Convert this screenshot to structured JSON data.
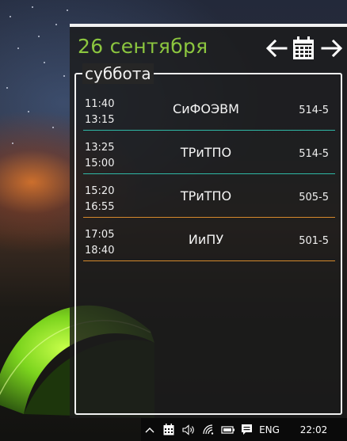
{
  "header": {
    "date": "26 сентября",
    "day": "суббота",
    "accent_color": "#8cc63f",
    "icons": {
      "prev": "arrow-left-icon",
      "calendar": "calendar-icon",
      "next": "arrow-right-icon"
    }
  },
  "lessons": [
    {
      "start": "11:40",
      "end": "13:15",
      "subject": "СиФОЭВМ",
      "room": "514-5",
      "line_color": "#2fb8a6"
    },
    {
      "start": "13:25",
      "end": "15:00",
      "subject": "ТРиТПО",
      "room": "514-5",
      "line_color": "#2fb8a6"
    },
    {
      "start": "15:20",
      "end": "16:55",
      "subject": "ТРиТПО",
      "room": "505-5",
      "line_color": "#d6892c"
    },
    {
      "start": "17:05",
      "end": "18:40",
      "subject": "ИиПУ",
      "room": "501-5",
      "line_color": "#d6892c"
    }
  ],
  "taskbar": {
    "language": "ENG",
    "clock": "22:02",
    "icons": [
      "chevron-up-icon",
      "calendar-tray-icon",
      "volume-icon",
      "network-icon",
      "battery-icon",
      "notification-icon"
    ]
  }
}
